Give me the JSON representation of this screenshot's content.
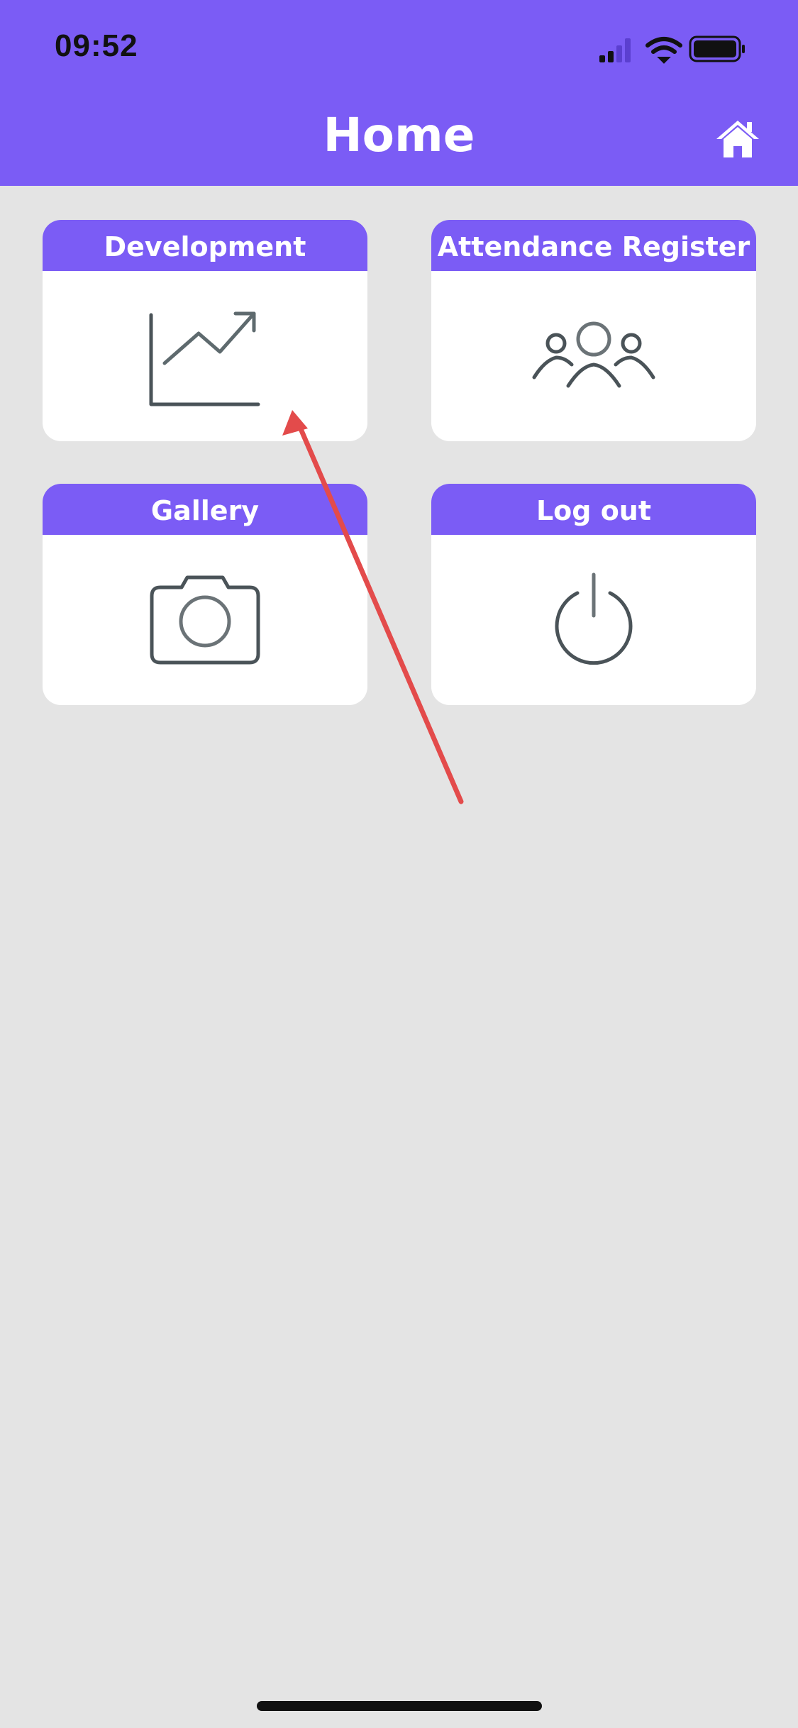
{
  "status_bar": {
    "time": "09:52",
    "icons": [
      "cellular-signal-icon",
      "wifi-icon",
      "battery-icon"
    ]
  },
  "header": {
    "title": "Home",
    "home_icon": "home-icon"
  },
  "tiles": [
    {
      "label": "Development",
      "icon": "trending-chart-icon"
    },
    {
      "label": "Attendance Register",
      "icon": "people-group-icon"
    },
    {
      "label": "Gallery",
      "icon": "camera-icon"
    },
    {
      "label": "Log out",
      "icon": "power-icon"
    }
  ],
  "colors": {
    "accent": "#7b5cf5",
    "background": "#e4e4e4",
    "tile_background": "#ffffff",
    "icon_stroke": "#4a5358",
    "annotation_arrow": "#e34b4b"
  }
}
